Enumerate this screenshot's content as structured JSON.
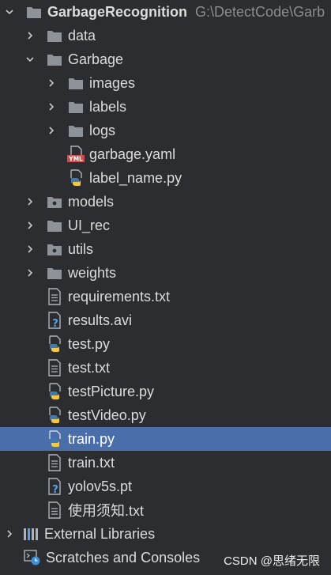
{
  "project": {
    "name": "GarbageRecognition",
    "path": "G:\\DetectCode\\Garb"
  },
  "tree": {
    "data": "data",
    "garbage": "Garbage",
    "images": "images",
    "labels": "labels",
    "logs": "logs",
    "garbage_yaml": "garbage.yaml",
    "label_name_py": "label_name.py",
    "models": "models",
    "ui_rec": "UI_rec",
    "utils": "utils",
    "weights": "weights",
    "requirements_txt": "requirements.txt",
    "results_avi": "results.avi",
    "test_py": "test.py",
    "test_txt": "test.txt",
    "testpicture_py": "testPicture.py",
    "testvideo_py": "testVideo.py",
    "train_py": "train.py",
    "train_txt": "train.txt",
    "yolov5s_pt": "yolov5s.pt",
    "instructions_txt": "使用须知.txt",
    "external_libraries": "External Libraries",
    "scratches": "Scratches and Consoles"
  },
  "yaml_badge": "YML",
  "watermark": "CSDN @思绪无限",
  "colors": {
    "background": "#2b2d30",
    "selection": "#4a6ea9",
    "folder": "#8d9399",
    "text": "#dcdcdc",
    "muted": "#8a8d92",
    "python_blue": "#3d7ab8",
    "python_yellow": "#f2c744",
    "yaml_red": "#c94f4f"
  },
  "selected_item": "train.py"
}
